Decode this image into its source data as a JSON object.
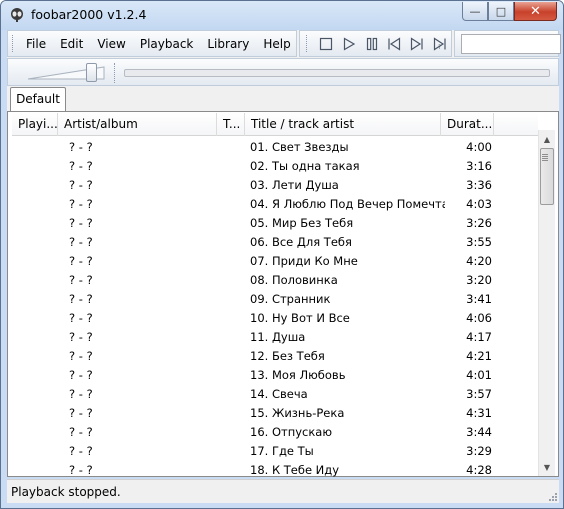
{
  "window": {
    "title": "foobar2000 v1.2.4",
    "caption_buttons": {
      "minimize": "—",
      "maximize": "□",
      "close": "✕"
    }
  },
  "menu": [
    "File",
    "Edit",
    "View",
    "Playback",
    "Library",
    "Help"
  ],
  "playback_controls": [
    "stop-icon",
    "play-icon",
    "pause-icon",
    "previous-icon",
    "next-icon",
    "random-icon"
  ],
  "search": {
    "value": ""
  },
  "tabs": [
    {
      "label": "Default",
      "active": true
    }
  ],
  "columns": {
    "playing": "Playi...",
    "artist_album": "Artist/album",
    "track_no": "T...",
    "title": "Title / track artist",
    "duration": "Durat..."
  },
  "tracks": [
    {
      "artist": "? - ?",
      "title": "01. Свет Звезды",
      "duration": "4:00"
    },
    {
      "artist": "? - ?",
      "title": "02. Ты одна такая",
      "duration": "3:16"
    },
    {
      "artist": "? - ?",
      "title": "03. Лети Душа",
      "duration": "3:36"
    },
    {
      "artist": "? - ?",
      "title": "04. Я Люблю Под Вечер Помечта...",
      "duration": "4:03"
    },
    {
      "artist": "? - ?",
      "title": "05.  Мир Без Тебя",
      "duration": "3:26"
    },
    {
      "artist": "? - ?",
      "title": "06.  Все Для Тебя",
      "duration": "3:55"
    },
    {
      "artist": "? - ?",
      "title": "07. Приди Ко Мне",
      "duration": "4:20"
    },
    {
      "artist": "? - ?",
      "title": "08. Половинка",
      "duration": "3:20"
    },
    {
      "artist": "? - ?",
      "title": "09. Странник",
      "duration": "3:41"
    },
    {
      "artist": "? - ?",
      "title": "10. Ну Вот И Все",
      "duration": "4:06"
    },
    {
      "artist": "? - ?",
      "title": "11.  Душа",
      "duration": "4:17"
    },
    {
      "artist": "? - ?",
      "title": "12. Без Тебя",
      "duration": "4:21"
    },
    {
      "artist": "? - ?",
      "title": "13. Моя Любовь",
      "duration": "4:01"
    },
    {
      "artist": "? - ?",
      "title": "14. Свеча",
      "duration": "3:57"
    },
    {
      "artist": "? - ?",
      "title": "15. Жизнь-Река",
      "duration": "4:31"
    },
    {
      "artist": "? - ?",
      "title": "16. Отпускаю",
      "duration": "3:44"
    },
    {
      "artist": "? - ?",
      "title": "17. Где Ты",
      "duration": "3:29"
    },
    {
      "artist": "? - ?",
      "title": "18. К Тебе Иду",
      "duration": "4:28"
    }
  ],
  "volume": {
    "level": 1.0
  },
  "seek": {
    "position": 0
  },
  "status": {
    "text": "Playback stopped."
  },
  "colors": {
    "title_bar": "#c9dcf3",
    "close_button": "#c8412b",
    "toolbar": "#f0f0f0"
  }
}
